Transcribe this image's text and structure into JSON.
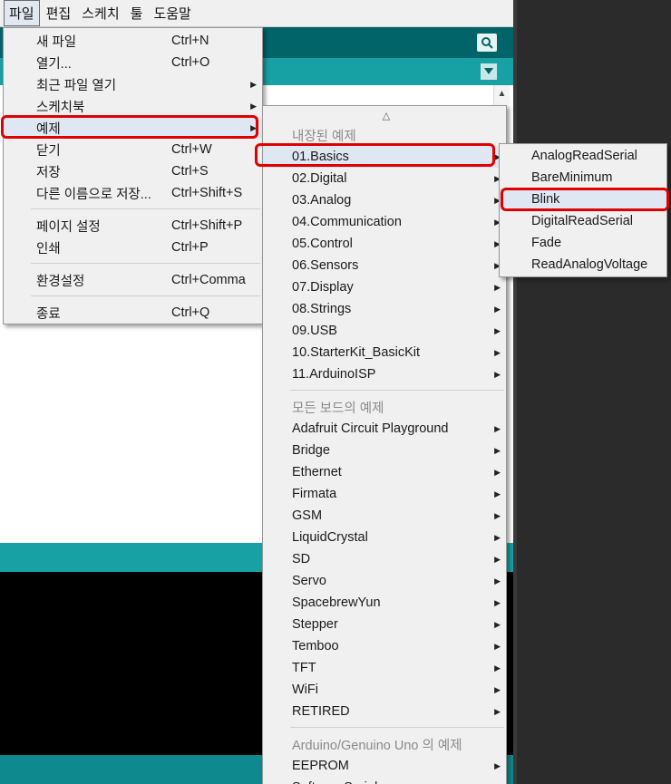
{
  "menubar": {
    "items": [
      "파일",
      "편집",
      "스케치",
      "툴",
      "도움말"
    ]
  },
  "file_menu": {
    "items": [
      {
        "label": "새 파일",
        "shortcut": "Ctrl+N"
      },
      {
        "label": "열기...",
        "shortcut": "Ctrl+O"
      },
      {
        "label": "최근 파일 열기",
        "shortcut": ""
      },
      {
        "label": "스케치북",
        "shortcut": ""
      },
      {
        "label": "예제",
        "shortcut": ""
      },
      {
        "label": "닫기",
        "shortcut": "Ctrl+W"
      },
      {
        "label": "저장",
        "shortcut": "Ctrl+S"
      },
      {
        "label": "다른 이름으로 저장...",
        "shortcut": "Ctrl+Shift+S"
      },
      {
        "label": "페이지 설정",
        "shortcut": "Ctrl+Shift+P"
      },
      {
        "label": "인쇄",
        "shortcut": "Ctrl+P"
      },
      {
        "label": "환경설정",
        "shortcut": "Ctrl+Comma"
      },
      {
        "label": "종료",
        "shortcut": "Ctrl+Q"
      }
    ]
  },
  "examples_menu": {
    "scroll_up": "△",
    "builtin_heading": "내장된 예제",
    "builtin": [
      "01.Basics",
      "02.Digital",
      "03.Analog",
      "04.Communication",
      "05.Control",
      "06.Sensors",
      "07.Display",
      "08.Strings",
      "09.USB",
      "10.StarterKit_BasicKit",
      "11.ArduinoISP"
    ],
    "all_boards_heading": "모든 보드의 예제",
    "all_boards": [
      "Adafruit Circuit Playground",
      "Bridge",
      "Ethernet",
      "Firmata",
      "GSM",
      "LiquidCrystal",
      "SD",
      "Servo",
      "SpacebrewYun",
      "Stepper",
      "Temboo",
      "TFT",
      "WiFi",
      "RETIRED"
    ],
    "board_heading": "Arduino/Genuino Uno 의 예제",
    "board": [
      "EEPROM",
      "SoftwareSerial"
    ]
  },
  "basics_menu": {
    "items": [
      "AnalogReadSerial",
      "BareMinimum",
      "Blink",
      "DigitalReadSerial",
      "Fade",
      "ReadAnalogVoltage"
    ]
  },
  "colors": {
    "toolbar": "#006468",
    "tabs": "#17a1a5",
    "highlight": "#e00000"
  }
}
